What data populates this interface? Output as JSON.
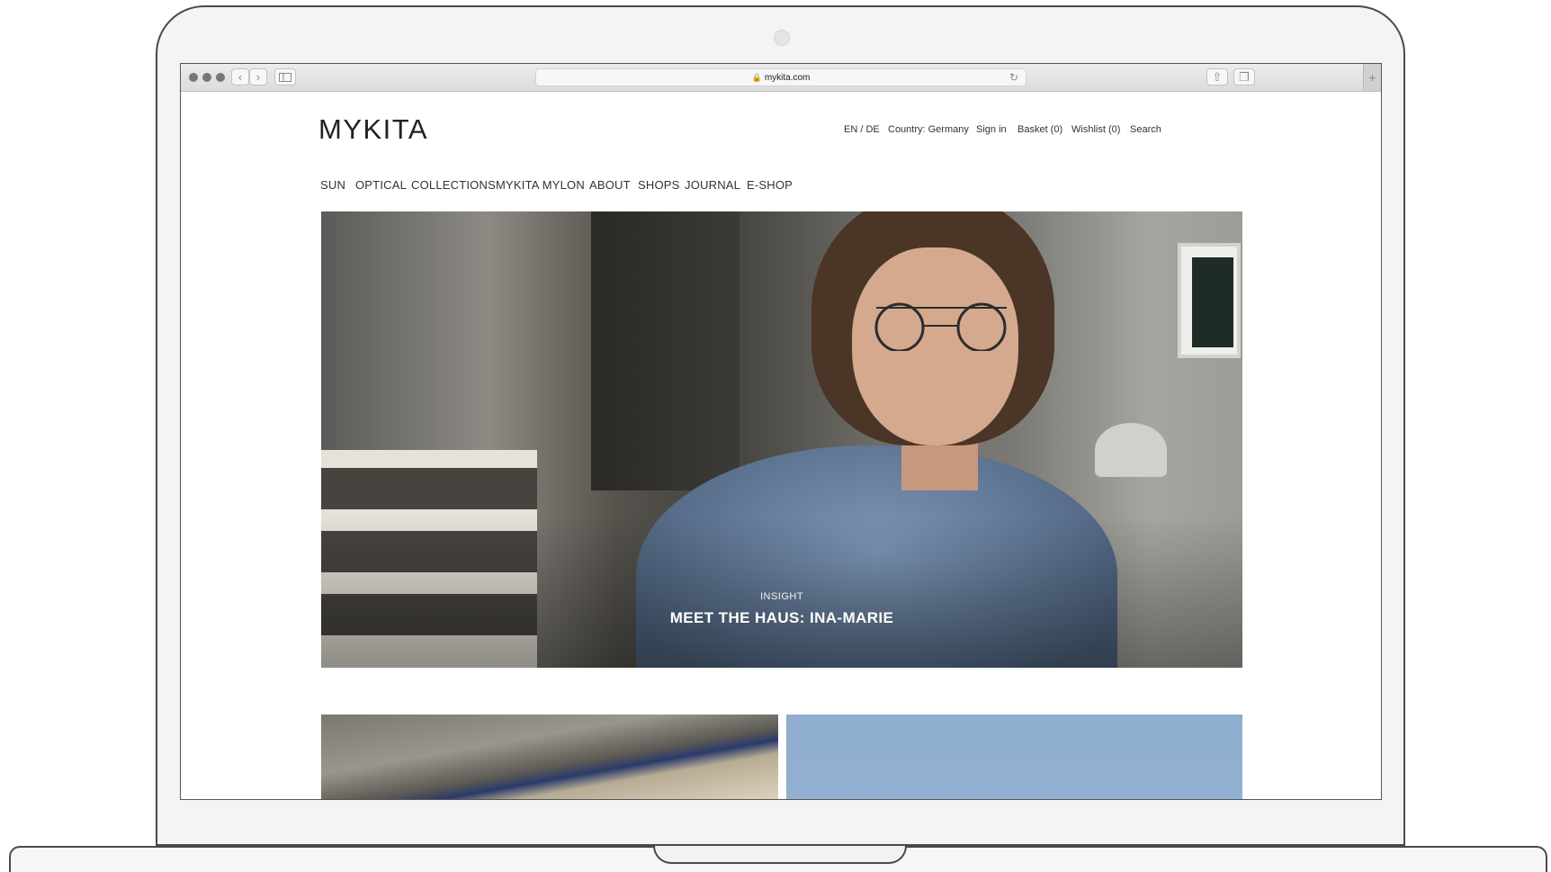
{
  "browser": {
    "url": "mykita.com",
    "back_icon": "chevron-left-icon",
    "forward_icon": "chevron-right-icon"
  },
  "site": {
    "logo": "MYKITA",
    "utility_nav": [
      "EN / DE",
      "Country: Germany",
      "Sign in",
      "Basket (0)",
      "Wishlist (0)",
      "Search"
    ],
    "main_nav": [
      "SUN",
      "OPTICAL",
      "COLLECTIONS",
      "MYKITA MYLON",
      "ABOUT",
      "SHOPS",
      "JOURNAL",
      "E-SHOP"
    ]
  },
  "hero": {
    "kicker": "INSIGHT",
    "title": "MEET THE HAUS: INA-MARIE"
  },
  "colors": {
    "text": "#333333",
    "hero_text": "#ffffff",
    "sky_tile": "#8fadd0"
  }
}
